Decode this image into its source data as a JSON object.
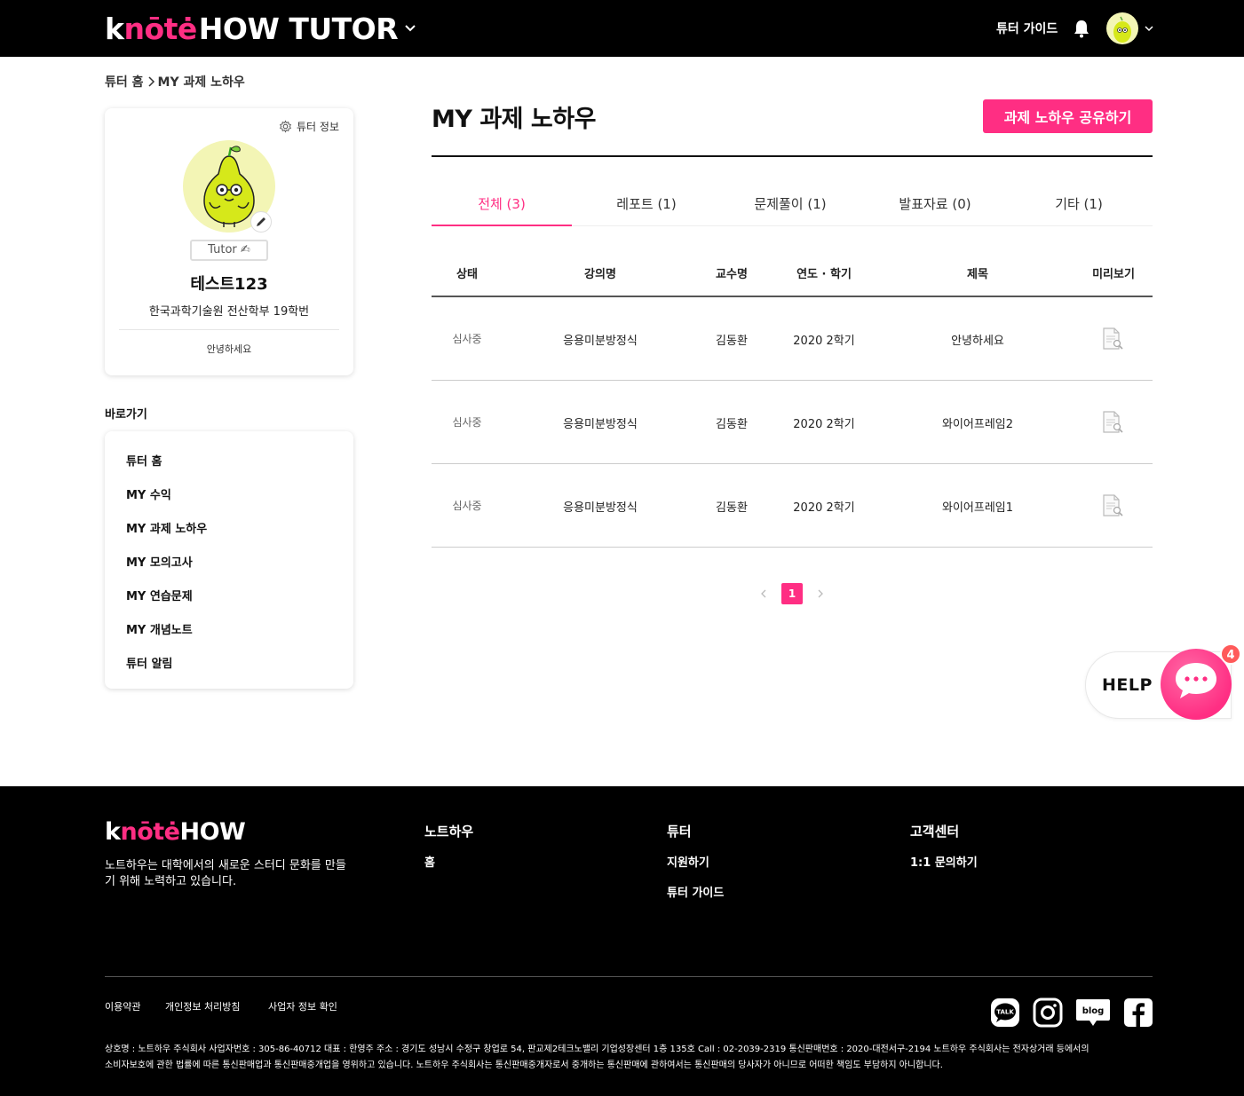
{
  "header": {
    "logo_main": "knote",
    "logo_suffix": "HOW TUTOR",
    "guide_link": "튜터 가이드"
  },
  "breadcrumb": {
    "home": "튜터 홈",
    "current": "MY 과제 노하우"
  },
  "profile": {
    "tutor_info_label": "튜터 정보",
    "badge": "Tutor ✍",
    "name": "테스트123",
    "school": "한국과학기술원 전산학부 19학번",
    "greeting": "안녕하세요"
  },
  "shortcuts": {
    "title": "바로가기",
    "items": [
      {
        "label": "튜터 홈"
      },
      {
        "label": "MY 수익"
      },
      {
        "label": "MY 과제 노하우"
      },
      {
        "label": "MY 모의고사"
      },
      {
        "label": "MY 연습문제"
      },
      {
        "label": "MY 개념노트"
      },
      {
        "label": "튜터 알림"
      }
    ]
  },
  "main": {
    "title": "MY 과제 노하우",
    "share_button": "과제 노하우 공유하기",
    "tabs": [
      {
        "label": "전체 (3)",
        "active": true
      },
      {
        "label": "레포트 (1)",
        "active": false
      },
      {
        "label": "문제풀이 (1)",
        "active": false
      },
      {
        "label": "발표자료 (0)",
        "active": false
      },
      {
        "label": "기타 (1)",
        "active": false
      }
    ],
    "table": {
      "headers": [
        "상태",
        "강의명",
        "교수명",
        "연도 · 학기",
        "제목",
        "미리보기"
      ],
      "rows": [
        {
          "status": "심사중",
          "course": "응용미분방정식",
          "professor": "김동환",
          "term": "2020 2학기",
          "title": "안녕하세요"
        },
        {
          "status": "심사중",
          "course": "응용미분방정식",
          "professor": "김동환",
          "term": "2020 2학기",
          "title": "와이어프레임2"
        },
        {
          "status": "심사중",
          "course": "응용미분방정식",
          "professor": "김동환",
          "term": "2020 2학기",
          "title": "와이어프레임1"
        }
      ]
    },
    "pagination": {
      "current_page": "1"
    }
  },
  "help": {
    "label": "HELP",
    "badge_count": "4"
  },
  "footer": {
    "logo_main": "knote",
    "logo_suffix": "HOW",
    "description": "노트하우는 대학에서의 새로운 스터디 문화를 만들기 위해 노력하고 있습니다.",
    "columns": [
      {
        "title": "노트하우",
        "links": [
          "홈"
        ]
      },
      {
        "title": "튜터",
        "links": [
          "지원하기",
          "튜터 가이드"
        ]
      },
      {
        "title": "고객센터",
        "links": [
          "1:1 문의하기"
        ]
      }
    ],
    "bottom_links": [
      "이용약관",
      "개인정보 처리방침",
      "사업자 정보 확인"
    ],
    "legal_line1": "상호명 : 노트하우 주식회사 사업자번호 : 305-86-40712 대표 : 한영주 주소 : 경기도 성남시 수정구 창업로 54, 판교제2테크노밸리 기업성장센터 1층 135호 Call : 02-2039-2319 통신판매번호 : 2020-대전서구-2194 노트하우 주식회사는 전자상거래 등에서의",
    "legal_line2": "소비자보호에 관한 법률에 따른 통신판매업과 통신판매중개업을 영위하고 있습니다. 노트하우 주식회사는 통신판매중개자로서 중개하는 통신판매에 관하여서는 통신판매의 당사자가 아니므로 어떠한 책임도 부담하지 아니합니다.",
    "social": {
      "talk_label": "TALK",
      "blog_label": "blog"
    }
  },
  "colors": {
    "accent": "#ff2e83",
    "header_bg": "#000000",
    "footer_bg": "#000000"
  }
}
